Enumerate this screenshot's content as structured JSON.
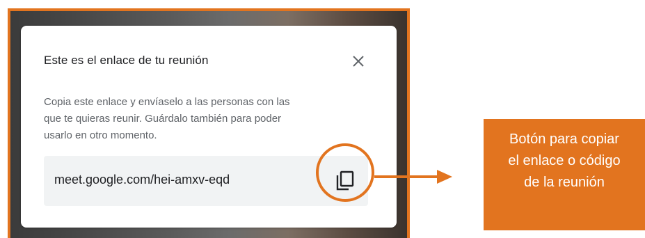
{
  "dialog": {
    "title": "Este es el enlace de tu reunión",
    "description_lines": [
      "Copia este enlace y envíaselo a las personas con las",
      "que te quieras reunir. Guárdalo también para poder",
      "usarlo en otro momento."
    ],
    "link": "meet.google.com/hei-amxv-eqd",
    "close_icon": "close-icon",
    "copy_icon": "copy-icon"
  },
  "annotation": {
    "callout_lines": [
      "Botón para copiar",
      "el enlace o código",
      "de la reunión"
    ],
    "accent_color": "#e2741f"
  }
}
